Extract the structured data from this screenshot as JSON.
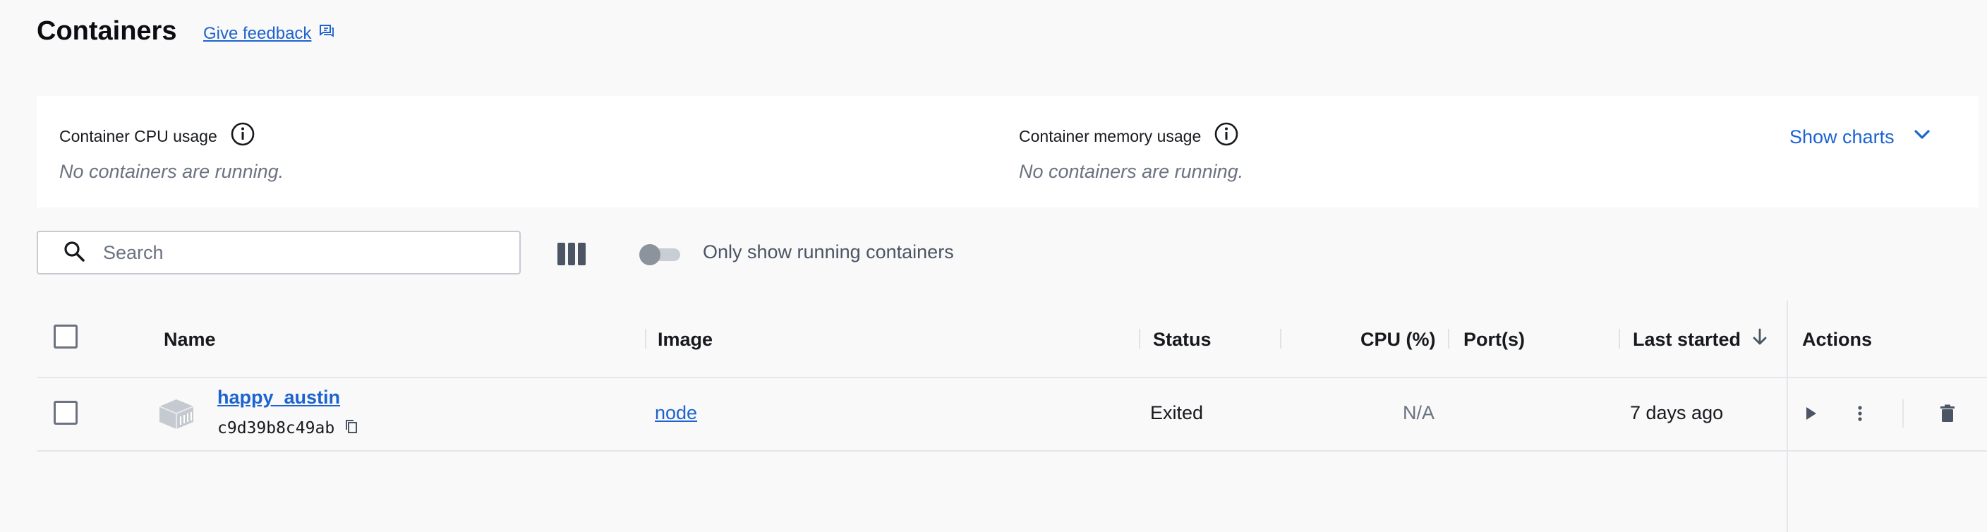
{
  "header": {
    "title": "Containers",
    "feedback_label": "Give feedback"
  },
  "usage": {
    "cpu_title": "Container CPU usage",
    "cpu_empty": "No containers are running.",
    "memory_title": "Container memory usage",
    "memory_empty": "No containers are running.",
    "show_charts_label": "Show charts"
  },
  "toolbar": {
    "search_placeholder": "Search",
    "search_value": "",
    "only_running_label": "Only show running containers",
    "only_running_enabled": false
  },
  "table": {
    "columns": [
      "Name",
      "Image",
      "Status",
      "CPU (%)",
      "Port(s)",
      "Last started",
      "Actions"
    ],
    "sort_column": "Last started",
    "sort_direction": "descending",
    "rows": [
      {
        "name": "happy_austin",
        "id": "c9d39b8c49ab",
        "image": "node",
        "status": "Exited",
        "cpu": "N/A",
        "ports": "",
        "last_started": "7 days ago"
      }
    ]
  },
  "icons": {
    "feedback": "feedback-icon",
    "info": "info-icon",
    "chevron": "chevron-down-icon",
    "search": "search-icon",
    "columns": "columns-icon",
    "container": "container-icon",
    "copy": "copy-icon",
    "sort": "arrow-down-icon",
    "start": "play-icon",
    "more": "more-vertical-icon",
    "delete": "trash-icon"
  },
  "colors": {
    "accent": "#1d63cf",
    "background": "#f9f9fa",
    "card": "#ffffff"
  }
}
